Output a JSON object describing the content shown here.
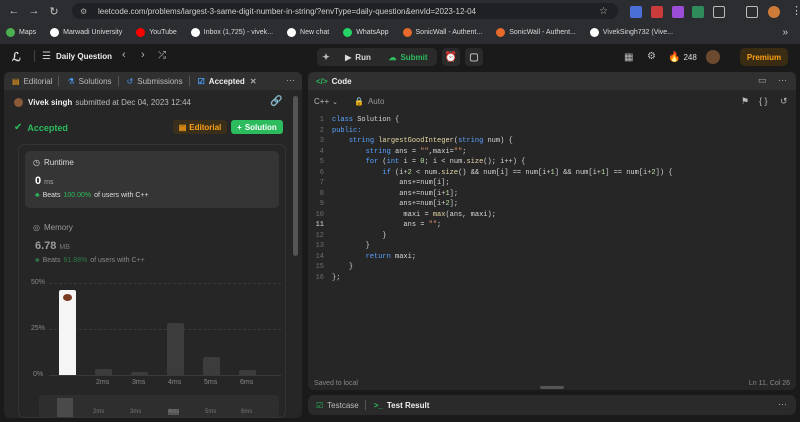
{
  "browser": {
    "url": "leetcode.com/problems/largest-3-same-digit-number-in-string/?envType=daily-question&envId=2023-12-04",
    "bookmarks": [
      {
        "label": "Maps",
        "color": "#4caf50"
      },
      {
        "label": "Marwadi University",
        "color": "#ffffff"
      },
      {
        "label": "YouTube",
        "color": "#ff0000"
      },
      {
        "label": "Inbox (1,725) - vivek...",
        "color": "#ffffff"
      },
      {
        "label": "New chat",
        "color": "#ffffff"
      },
      {
        "label": "WhatsApp",
        "color": "#25d366"
      },
      {
        "label": "SonicWall - Authent...",
        "color": "#e66a2c"
      },
      {
        "label": "SonicWall - Authent...",
        "color": "#e66a2c"
      },
      {
        "label": "VivekSingh732 (Vive...",
        "color": "#ffffff"
      }
    ],
    "more": "»"
  },
  "topbar": {
    "title": "Daily Question",
    "run": "Run",
    "submit": "Submit",
    "streak": "248",
    "premium": "Premium"
  },
  "left": {
    "tabs": {
      "editorial": "Editorial",
      "solutions": "Solutions",
      "submissions": "Submissions",
      "accepted": "Accepted"
    },
    "user": "Vivek singh",
    "submitted_text": "submitted at Dec 04, 2023 12:44",
    "status": "Accepted",
    "editorial_btn": "Editorial",
    "solution_btn": "Solution",
    "runtime": {
      "label": "Runtime",
      "value": "0",
      "unit": "ms",
      "beats_prefix": "Beats",
      "beats_value": "100.00%",
      "beats_suffix": "of users with C++"
    },
    "memory": {
      "label": "Memory",
      "value": "6.78",
      "unit": "MB",
      "beats_prefix": "Beats",
      "beats_value": "91.88%",
      "beats_suffix": "of users with C++"
    }
  },
  "chart_data": {
    "type": "bar",
    "y_ticks": [
      "50%",
      "25%",
      "0%"
    ],
    "ylim": [
      0,
      50
    ],
    "categories": [
      "0ms",
      "2ms",
      "3ms",
      "4ms",
      "5ms",
      "6ms"
    ],
    "tick_labels": [
      "2ms",
      "3ms",
      "4ms",
      "5ms",
      "6ms"
    ],
    "values": [
      46,
      3,
      1.5,
      28,
      10,
      2.5
    ],
    "highlight_index": 0
  },
  "code": {
    "title": "Code",
    "language": "C++",
    "mode": "Auto",
    "lines": [
      "class Solution {",
      "public:",
      "    string largestGoodInteger(string num) {",
      "        string ans = \"\",maxi=\"\";",
      "        for (int i = 0; i < num.size(); i++) {",
      "            if (i+2 < num.size() && num[i] == num[i+1] && num[i+1] == num[i+2]) {",
      "                ans+=num[i];",
      "                ans+=num[i+1];",
      "                ans+=num[i+2];",
      "                 maxi = max(ans, maxi);",
      "                 ans = \"\";",
      "            }",
      "        }",
      "        return maxi;",
      "    }",
      "};"
    ],
    "status": "Saved to local",
    "position": "Ln 11, Col 26"
  },
  "bottom": {
    "testcase": "Testcase",
    "test_result": "Test Result"
  }
}
